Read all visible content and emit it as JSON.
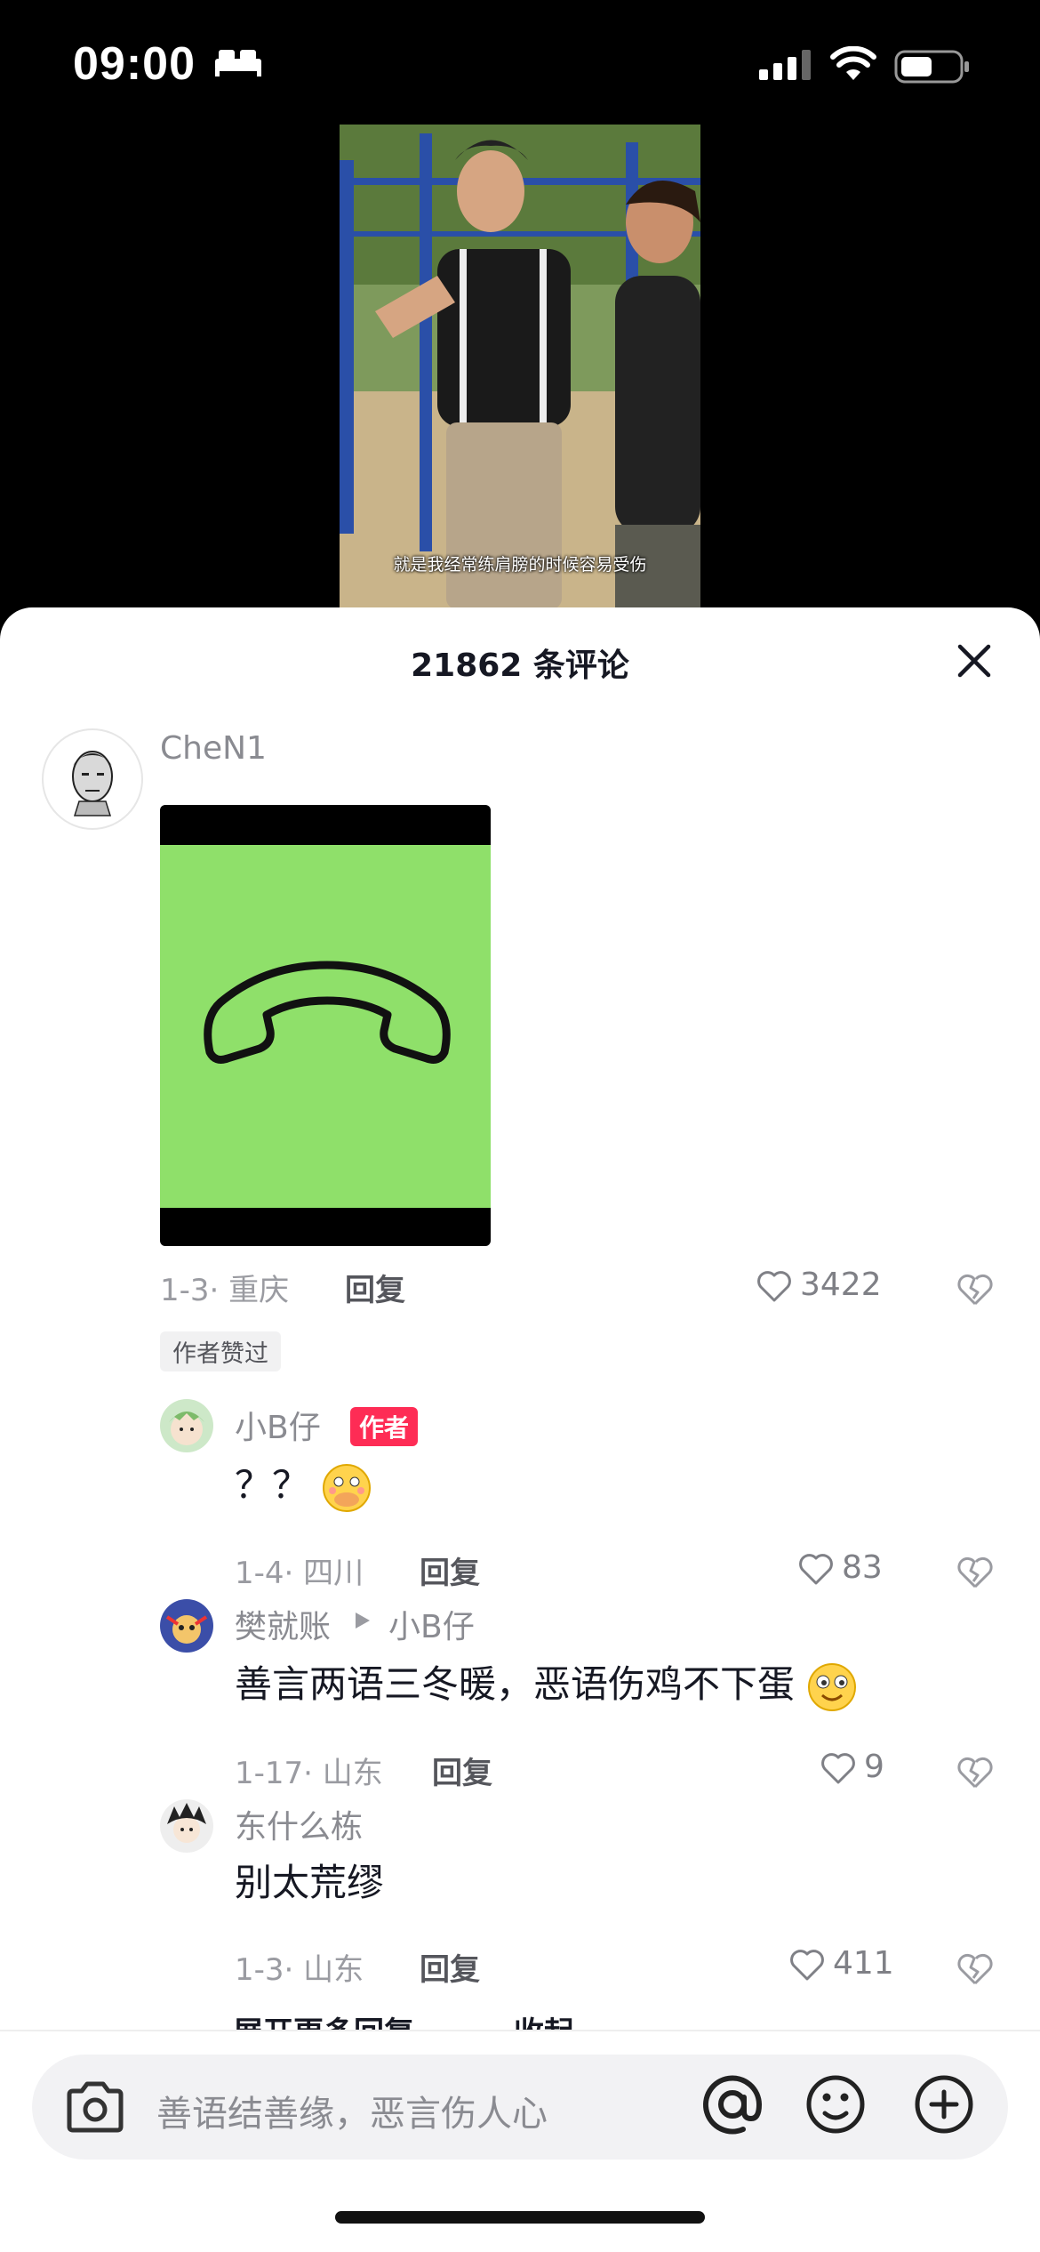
{
  "status_bar": {
    "time": "09:00"
  },
  "video": {
    "subtitle": "就是我经常练肩膀的时候容易受伤"
  },
  "comments_panel": {
    "title": "21862 条评论",
    "comment": {
      "username": "CheN1",
      "date": "1-3",
      "location": "重庆",
      "reply_label": "回复",
      "likes": "3422",
      "badge": "作者赞过",
      "sticker": "phone-hangup-sticker"
    },
    "replies": [
      {
        "username": "小B仔",
        "badge": "作者",
        "text": "？？",
        "date": "1-4",
        "location": "四川",
        "reply_label": "回复",
        "likes": "83"
      },
      {
        "username": "樊就账",
        "reply_to": "小B仔",
        "text": "善言两语三冬暖，恶语伤鸡不下蛋",
        "date": "1-17",
        "location": "山东",
        "reply_label": "回复",
        "likes": "9"
      },
      {
        "username": "东什么栋",
        "text": "别太荒缪",
        "date": "1-3",
        "location": "山东",
        "reply_label": "回复",
        "likes": "411"
      }
    ],
    "more_replies": "展开更多回复",
    "collapse": "收起"
  },
  "input_bar": {
    "placeholder": "善语结善缘，恶言伤人心"
  },
  "colors": {
    "author_badge": "#fe2c55",
    "sticker_bg": "#8fe06a",
    "background": "#000000"
  }
}
